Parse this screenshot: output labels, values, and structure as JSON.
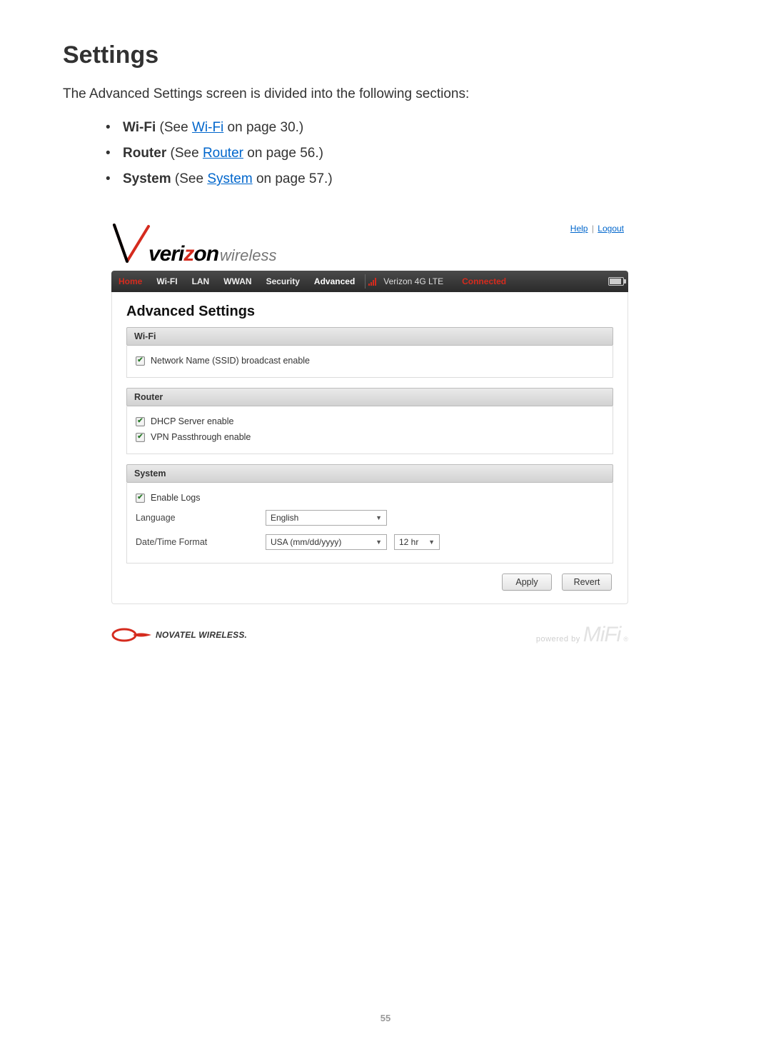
{
  "doc": {
    "heading": "Settings",
    "intro": "The Advanced Settings screen is divided into the following sections:",
    "bullets": [
      {
        "bold": "Wi-Fi",
        "pre": " (See ",
        "link": "Wi-Fi",
        "post": " on page 30.)"
      },
      {
        "bold": "Router",
        "pre": " (See ",
        "link": "Router",
        "post": " on page 56.)"
      },
      {
        "bold": "System",
        "pre": " (See ",
        "link": "System",
        "post": " on page 57.)"
      }
    ],
    "page_number": "55"
  },
  "ui": {
    "top_links": {
      "help": "Help",
      "logout": "Logout"
    },
    "brand": {
      "veri": "veri",
      "z": "z",
      "on": "on",
      "wireless": "wireless"
    },
    "nav": {
      "tabs": [
        "Home",
        "Wi-FI",
        "LAN",
        "WWAN",
        "Security",
        "Advanced"
      ],
      "carrier": "Verizon  4G LTE",
      "connected": "Connected"
    },
    "panel_title": "Advanced Settings",
    "sections": {
      "wifi": {
        "title": "Wi-Fi",
        "opt_ssid": "Network Name (SSID) broadcast enable"
      },
      "router": {
        "title": "Router",
        "opt_dhcp": "DHCP Server enable",
        "opt_vpn": "VPN Passthrough enable"
      },
      "system": {
        "title": "System",
        "opt_logs": "Enable Logs",
        "language_label": "Language",
        "language_value": "English",
        "datefmt_label": "Date/Time Format",
        "datefmt_value": "USA (mm/dd/yyyy)",
        "timefmt_value": "12 hr"
      }
    },
    "buttons": {
      "apply": "Apply",
      "revert": "Revert"
    },
    "footer": {
      "novatel": "NOVATEL WIRELESS.",
      "powered_by": "powered by",
      "mifi": "MiFi",
      "reg": "®"
    }
  }
}
